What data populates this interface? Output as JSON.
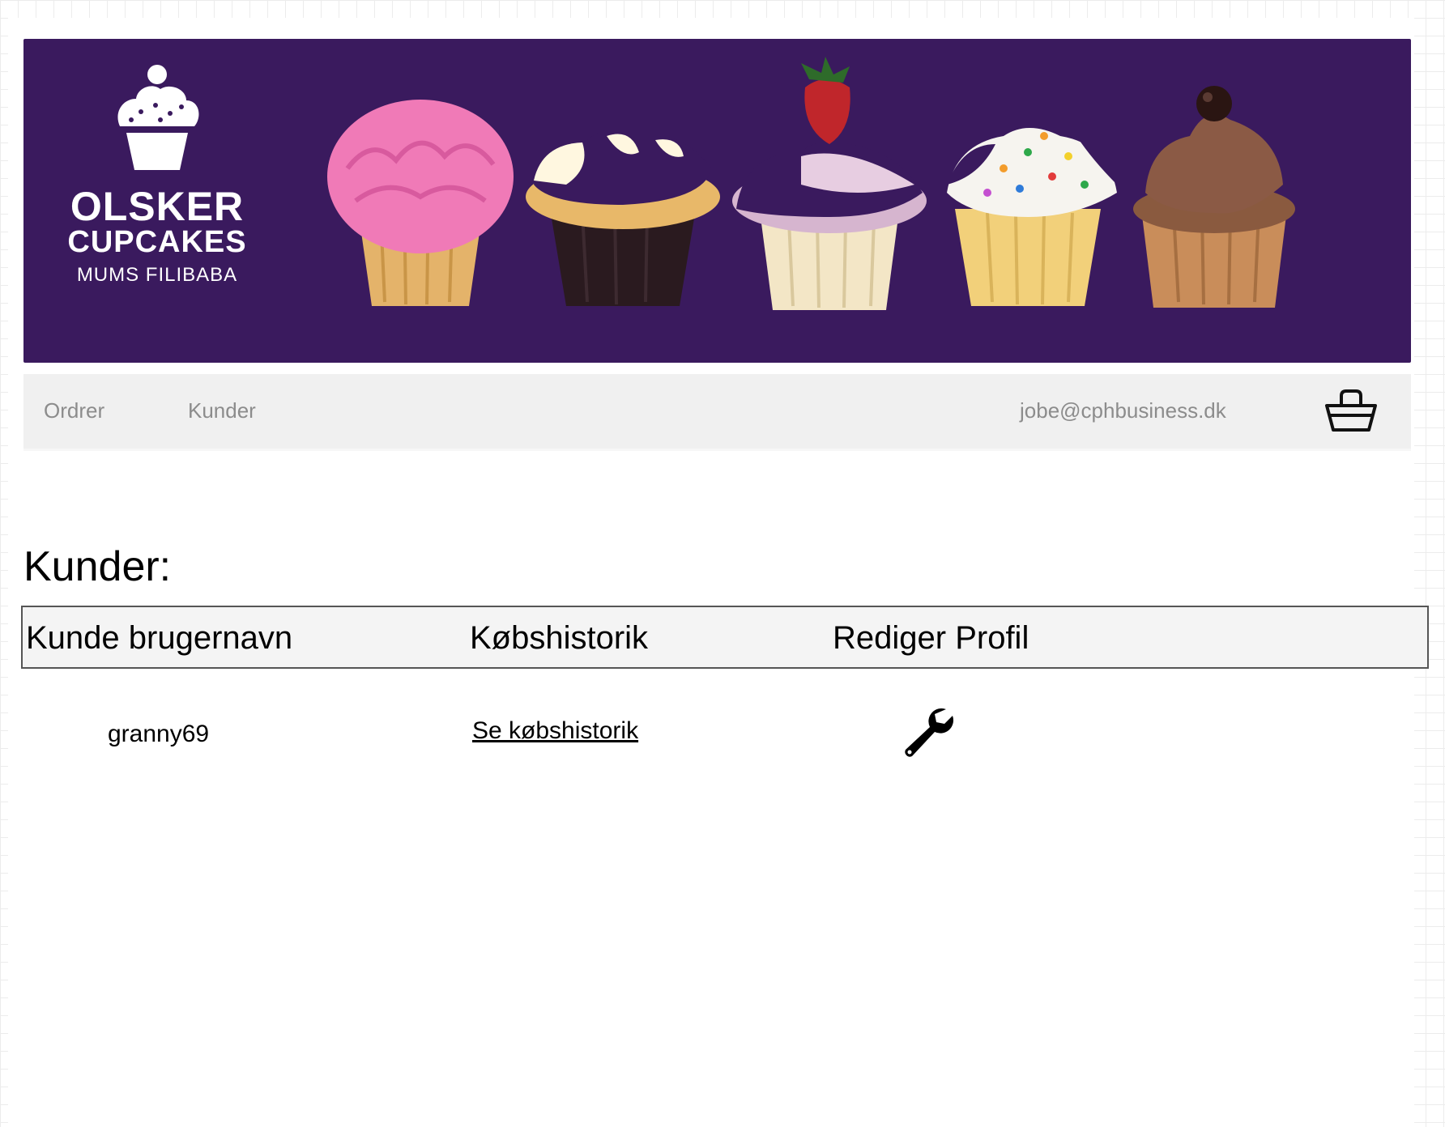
{
  "brand": {
    "line1": "OLSKER",
    "line2": "CUPCAKES",
    "line3": "MUMS FILIBABA",
    "banner_color": "#3a1a5e"
  },
  "nav": {
    "items": [
      {
        "label": "Ordrer"
      },
      {
        "label": "Kunder"
      }
    ],
    "user_email": "jobe@cphbusiness.dk",
    "basket_icon": "basket-icon"
  },
  "page": {
    "title": "Kunder:"
  },
  "table": {
    "columns": [
      "Kunde brugernavn",
      "Købshistorik",
      "Rediger Profil"
    ],
    "rows": [
      {
        "username": "granny69",
        "history_link": "Se købshistorik",
        "edit_icon": "wrench-icon"
      }
    ]
  }
}
